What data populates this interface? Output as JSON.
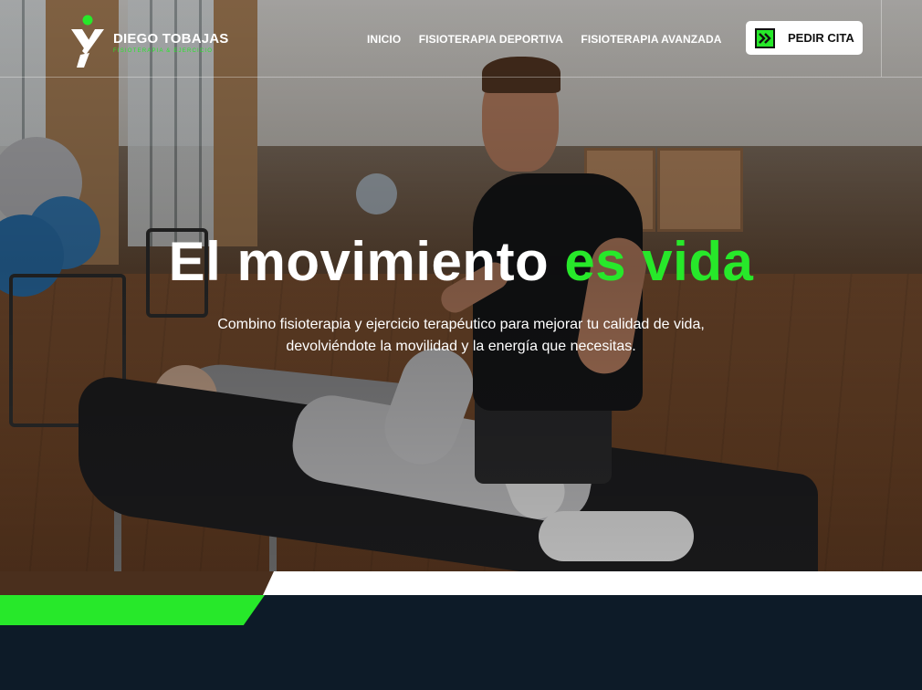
{
  "brand": {
    "name": "DIEGO TOBAJAS",
    "tagline": "FISIOTERAPIA & EJERCICIO",
    "accent_color": "#27e82a",
    "dark_color": "#0d1b28"
  },
  "nav": {
    "items": [
      {
        "label": "INICIO"
      },
      {
        "label": "FISIOTERAPIA DEPORTIVA"
      },
      {
        "label": "FISIOTERAPIA AVANZADA"
      }
    ]
  },
  "cta": {
    "label": "PEDIR CITA",
    "icon": "double-chevron-right-icon"
  },
  "hero": {
    "title_main": "El movimiento ",
    "title_accent": "es vida",
    "text": "Combino fisioterapia y ejercicio terapéutico para mejorar tu calidad de vida, devolviéndote la movilidad y la energía que necesitas."
  }
}
